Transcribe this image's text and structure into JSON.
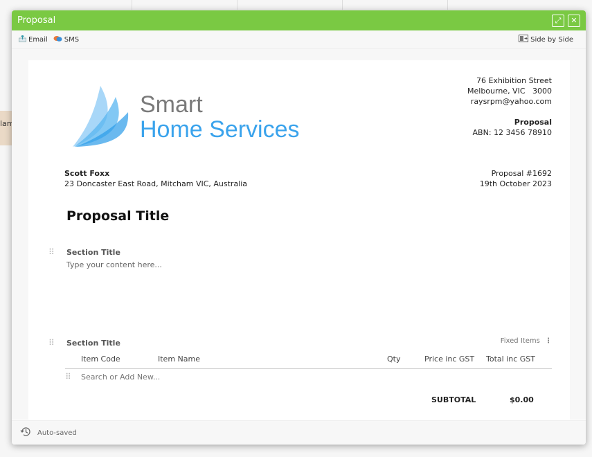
{
  "background": {
    "row_label": "lam"
  },
  "modal": {
    "title": "Proposal",
    "title_bar_color": "#7ac943",
    "expand_glyph": "⤢",
    "close_glyph": "✕"
  },
  "toolbar": {
    "email_label": "Email",
    "sms_label": "SMS",
    "side_by_side_label": "Side by Side"
  },
  "logo": {
    "line1": "Smart",
    "line2": "Home Services",
    "brand_color": "#3aa3ec"
  },
  "company": {
    "street": "76 Exhibition Street",
    "city": "Melbourne, VIC   3000",
    "email": "raysrpm@yahoo.com",
    "doc_type": "Proposal",
    "abn": "ABN: 12 3456 78910"
  },
  "client": {
    "name": "Scott Foxx",
    "address": "23 Doncaster East Road, Mitcham VIC, Australia"
  },
  "proposal": {
    "number": "Proposal #1692",
    "date": "19th October 2023",
    "title": "Proposal Title"
  },
  "section1": {
    "title": "Section Title",
    "body": "Type your content here..."
  },
  "section2": {
    "title": "Section Title",
    "fixed_items_label": "Fixed Items",
    "columns": [
      "Item Code",
      "Item Name",
      "Qty",
      "Price inc GST",
      "Total inc GST"
    ],
    "search_placeholder": "Search or Add New...",
    "subtotal_label": "SUBTOTAL",
    "subtotal_value": "$0.00"
  },
  "footer": {
    "status": "Auto-saved"
  }
}
